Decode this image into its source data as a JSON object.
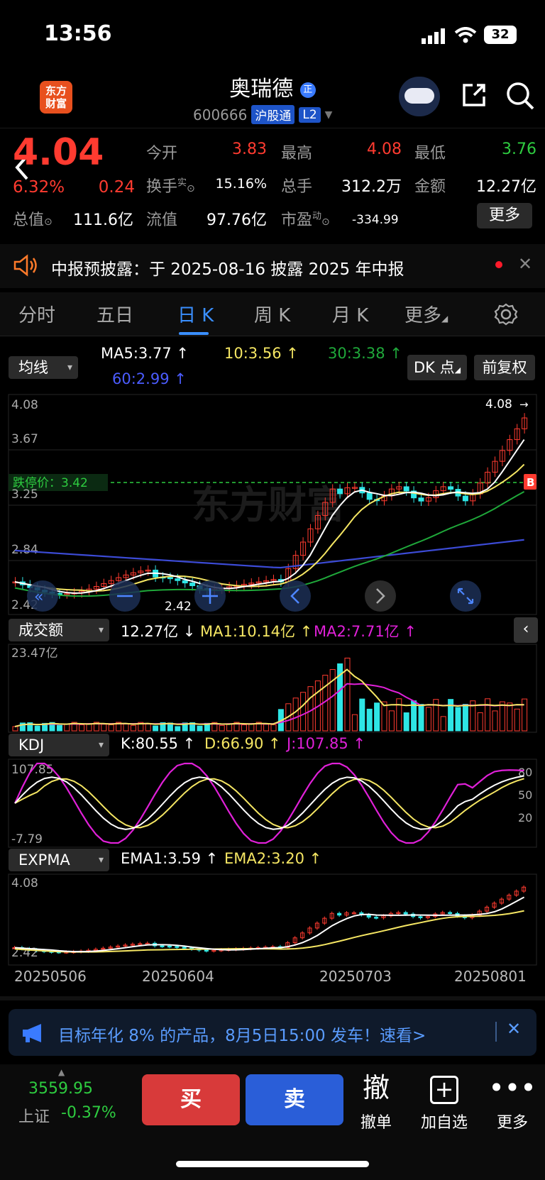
{
  "status": {
    "time": "13:56",
    "battery": "32"
  },
  "header": {
    "logo_text": "东方\n财富",
    "stock_name": "奥瑞德",
    "name_badge": "正",
    "stock_code": "600666",
    "tag1": "沪股通",
    "tag2": "L2"
  },
  "quote": {
    "price": "4.04",
    "change_pct": "6.32%",
    "change_amt": "0.24",
    "open_label": "今开",
    "open": "3.83",
    "high_label": "最高",
    "high": "4.08",
    "low_label": "最低",
    "low": "3.76",
    "turnover_label": "换手",
    "turnover_sup": "实",
    "turnover": "15.16%",
    "volume_label": "总手",
    "volume": "312.2万",
    "amount_label": "金额",
    "amount": "12.27亿",
    "mcap_label": "总值",
    "mcap": "111.6亿",
    "float_label": "流值",
    "float": "97.76亿",
    "pe_label": "市盈",
    "pe_sup": "动",
    "pe": "-334.99",
    "more": "更多"
  },
  "notice": {
    "text": "中报预披露：于 2025-08-16 披露 2025 年中报"
  },
  "tabs": [
    "分时",
    "五日",
    "日 K",
    "周 K",
    "月 K",
    "更多"
  ],
  "active_tab": 2,
  "ma_panel": {
    "select": "均线",
    "ma5": "MA5:3.77 ↑",
    "ma10": "10:3.56 ↑",
    "ma30": "30:3.38 ↑",
    "ma60": "60:2.99 ↑",
    "dk": "DK 点",
    "fq": "前复权",
    "y_labels": [
      "4.08",
      "3.67",
      "3.25",
      "2.84",
      "2.42"
    ],
    "limit_label": "跌停价：3.42",
    "max_label": "4.08",
    "min_label": "2.42",
    "b_marker": "B",
    "watermark": "东方财富"
  },
  "volume_panel": {
    "select": "成交额",
    "value": "12.27亿 ↓",
    "ma1": "MA1:10.14亿 ↑",
    "ma2": "MA2:7.71亿 ↑",
    "y_label": "23.47亿"
  },
  "kdj_panel": {
    "select": "KDJ",
    "k": "K:80.55 ↑",
    "d": "D:66.90 ↑",
    "j": "J:107.85 ↑",
    "y_top": "107.85",
    "y_bottom": "-7.79",
    "r80": "80",
    "r50": "50",
    "r20": "20"
  },
  "expma_panel": {
    "select": "EXPMA",
    "ema1": "EMA1:3.59 ↑",
    "ema2": "EMA2:3.20 ↑",
    "y_top": "4.08",
    "y_bottom": "2.42"
  },
  "dates": [
    "20250506",
    "20250604",
    "20250703",
    "20250801"
  ],
  "promo": {
    "text": "目标年化 8% 的产品，8月5日15:00 发车！速看>"
  },
  "bottom": {
    "index_value": "3559.95",
    "index_name": "上证",
    "index_change": "-0.37%",
    "buy": "买",
    "sell": "卖",
    "cancel_icon": "撤",
    "cancel": "撤单",
    "add": "加自选",
    "more": "更多"
  },
  "colors": {
    "up": "#ff3b30",
    "down": "#2ecc40",
    "accent": "#3a8fff",
    "ma5": "#ffffff",
    "ma10": "#f5e663",
    "ma30": "#1fa83a",
    "ma60": "#3c4bd6",
    "kdj_j": "#e020d8"
  }
}
